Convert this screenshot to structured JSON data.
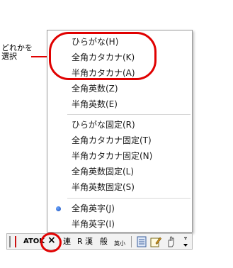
{
  "callout": {
    "line1": "どれかを",
    "line2": "選択"
  },
  "menu": {
    "items": [
      {
        "label": "ひらがな(H)"
      },
      {
        "label": "全角カタカナ(K)"
      },
      {
        "label": "半角カタカナ(A)"
      },
      {
        "label": "全角英数(Z)"
      },
      {
        "label": "半角英数(E)"
      },
      {
        "label": "ひらがな固定(R)"
      },
      {
        "label": "全角カタカナ固定(T)"
      },
      {
        "label": "半角カタカナ固定(N)"
      },
      {
        "label": "全角英数固定(L)"
      },
      {
        "label": "半角英数固定(S)"
      },
      {
        "label": "全角英字(J)",
        "checked": true
      },
      {
        "label": "半角英字(I)"
      }
    ]
  },
  "toolbar": {
    "logo": "ATOK",
    "mode": "×",
    "conv": "連",
    "r_label": "R",
    "kanji": "漢",
    "general": "般",
    "eisho": "英小"
  },
  "colors": {
    "highlight": "#e00000",
    "menu_border": "#9a9a9a"
  }
}
